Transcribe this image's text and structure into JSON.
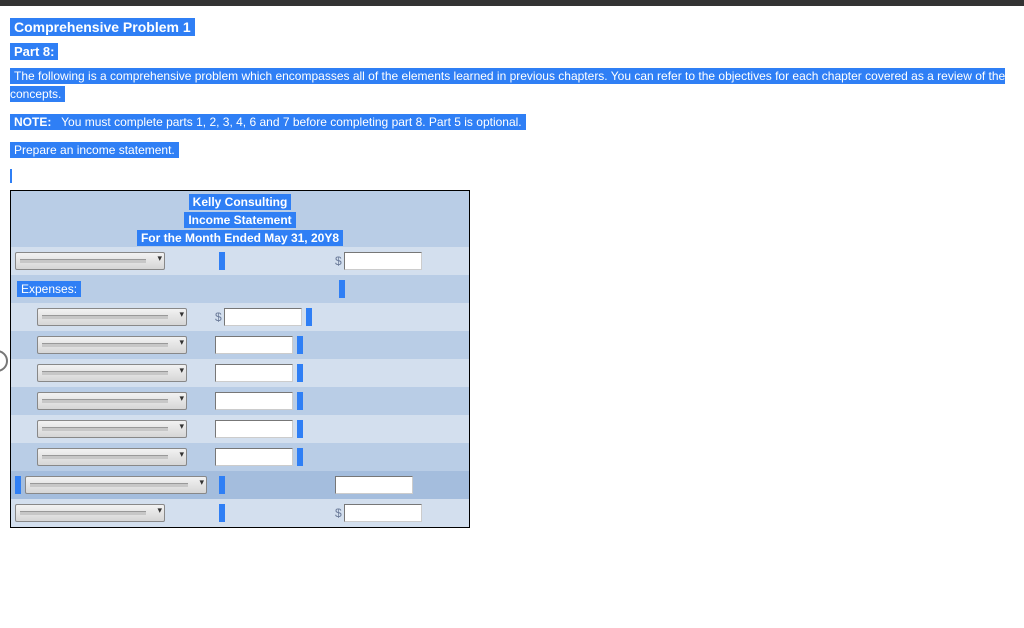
{
  "header": {
    "title1": "Comprehensive Problem 1",
    "title2": "Part 8:"
  },
  "intro": "The following is a comprehensive problem which encompasses all of the elements learned in previous chapters. You can refer to the objectives for each chapter covered as a review of the concepts.",
  "note_label": "NOTE:",
  "note_body": "You must complete parts 1, 2, 3, 4, 6 and 7 before completing part 8. Part 5 is optional.",
  "instruction": "Prepare an income statement.",
  "statement": {
    "company": "Kelly Consulting",
    "report": "Income Statement",
    "period": "For the Month Ended May 31, 20Y8",
    "expenses_label": "Expenses:",
    "currency_symbol": "$"
  }
}
